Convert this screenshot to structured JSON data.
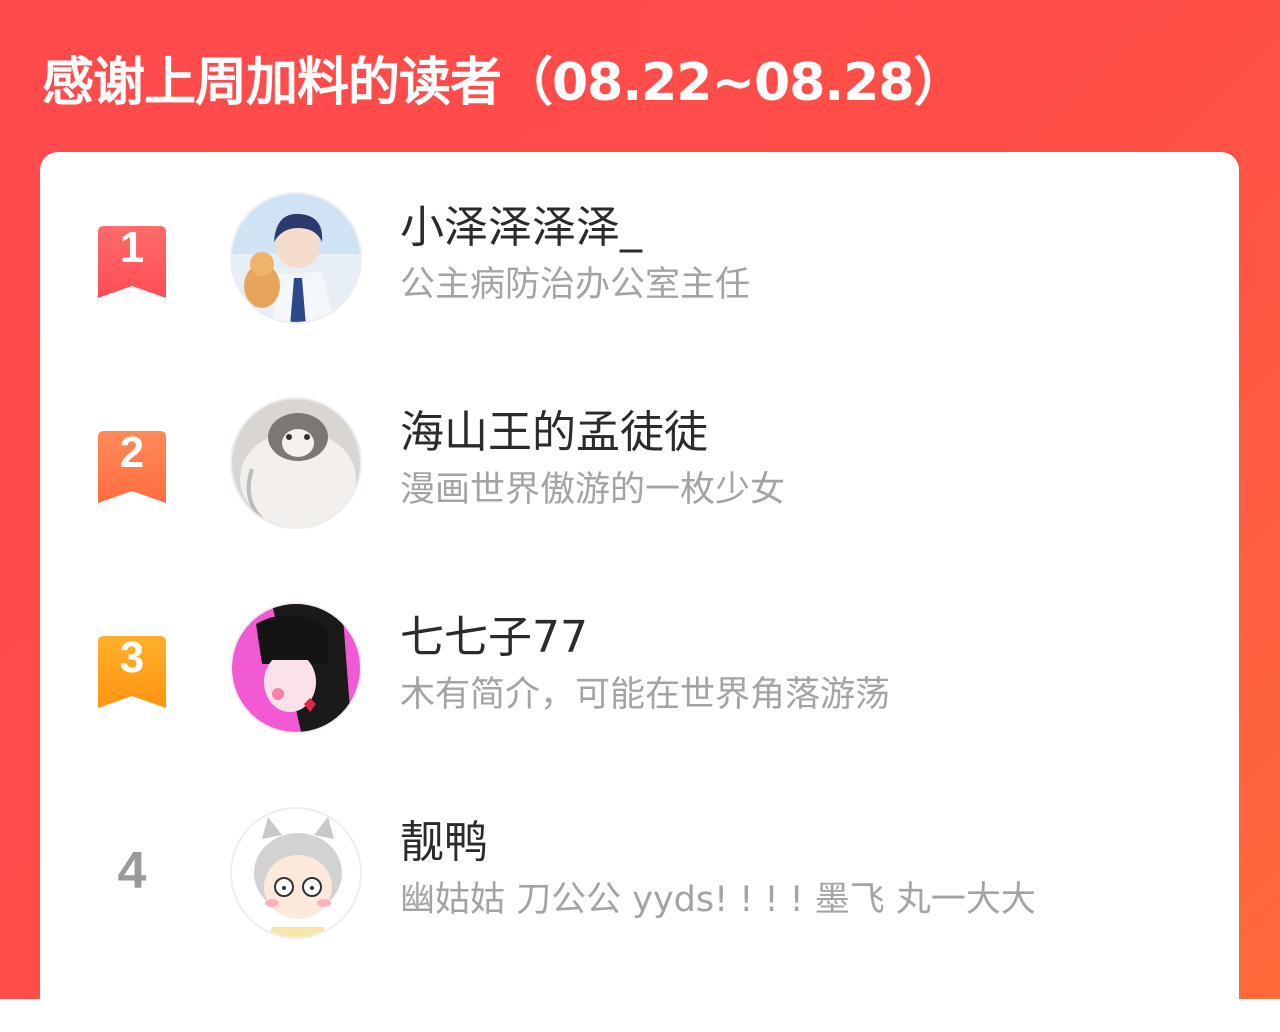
{
  "header": {
    "title": "感谢上周加料的读者（08.22~08.28）"
  },
  "colors": {
    "banner_red": "#ff4a4d",
    "rank1": "#ff5a5f",
    "rank2": "#ff7a4a",
    "rank3": "#ffa21c",
    "rank_plain": "#9a9a9a"
  },
  "readers": [
    {
      "rank": "1",
      "name": "小泽泽泽泽_",
      "desc": "公主病防治办公室主任",
      "avatar": "boy-with-cat-avatar"
    },
    {
      "rank": "2",
      "name": "海山王的孟徒徒",
      "desc": "漫画世界傲游的一枚少女",
      "avatar": "fluffy-cat-avatar"
    },
    {
      "rank": "3",
      "name": "七七子77",
      "desc": "木有简介，可能在世界角落游荡",
      "avatar": "pink-anime-girl-avatar"
    },
    {
      "rank": "4",
      "name": "靓鸭",
      "desc": "幽姑姑 刀公公 yyds! ! ! ! 墨飞 丸一大大",
      "avatar": "cat-ear-girl-avatar"
    }
  ]
}
